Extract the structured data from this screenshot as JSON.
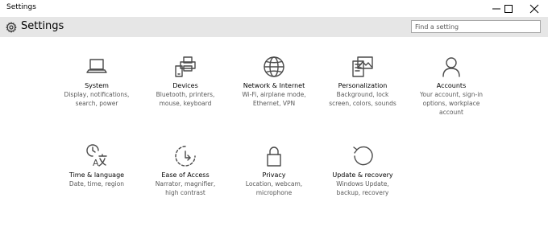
{
  "window": {
    "title": "Settings",
    "minimize_icon": "minimize-icon",
    "maximize_icon": "maximize-icon",
    "close_icon": "close-icon"
  },
  "header": {
    "icon": "gear-icon",
    "title": "Settings",
    "search_placeholder": "Find a setting"
  },
  "tiles": [
    {
      "icon": "laptop-icon",
      "name": "System",
      "desc": "Display, notifications,\nsearch, power"
    },
    {
      "icon": "devices-icon",
      "name": "Devices",
      "desc": "Bluetooth, printers,\nmouse, keyboard"
    },
    {
      "icon": "globe-icon",
      "name": "Network & Internet",
      "desc": "Wi-Fi, airplane mode,\nEthernet, VPN"
    },
    {
      "icon": "personalization-icon",
      "name": "Personalization",
      "desc": "Background, lock\nscreen, colors, sounds"
    },
    {
      "icon": "person-icon",
      "name": "Accounts",
      "desc": "Your account, sign-in\noptions, workplace\naccount"
    },
    {
      "icon": "time-language-icon",
      "name": "Time & language",
      "desc": "Date, time, region"
    },
    {
      "icon": "ease-of-access-icon",
      "name": "Ease of Access",
      "desc": "Narrator, magnifier,\nhigh contrast"
    },
    {
      "icon": "lock-icon",
      "name": "Privacy",
      "desc": "Location, webcam,\nmicrophone"
    },
    {
      "icon": "update-icon",
      "name": "Update & recovery",
      "desc": "Windows Update,\nbackup, recovery"
    }
  ]
}
